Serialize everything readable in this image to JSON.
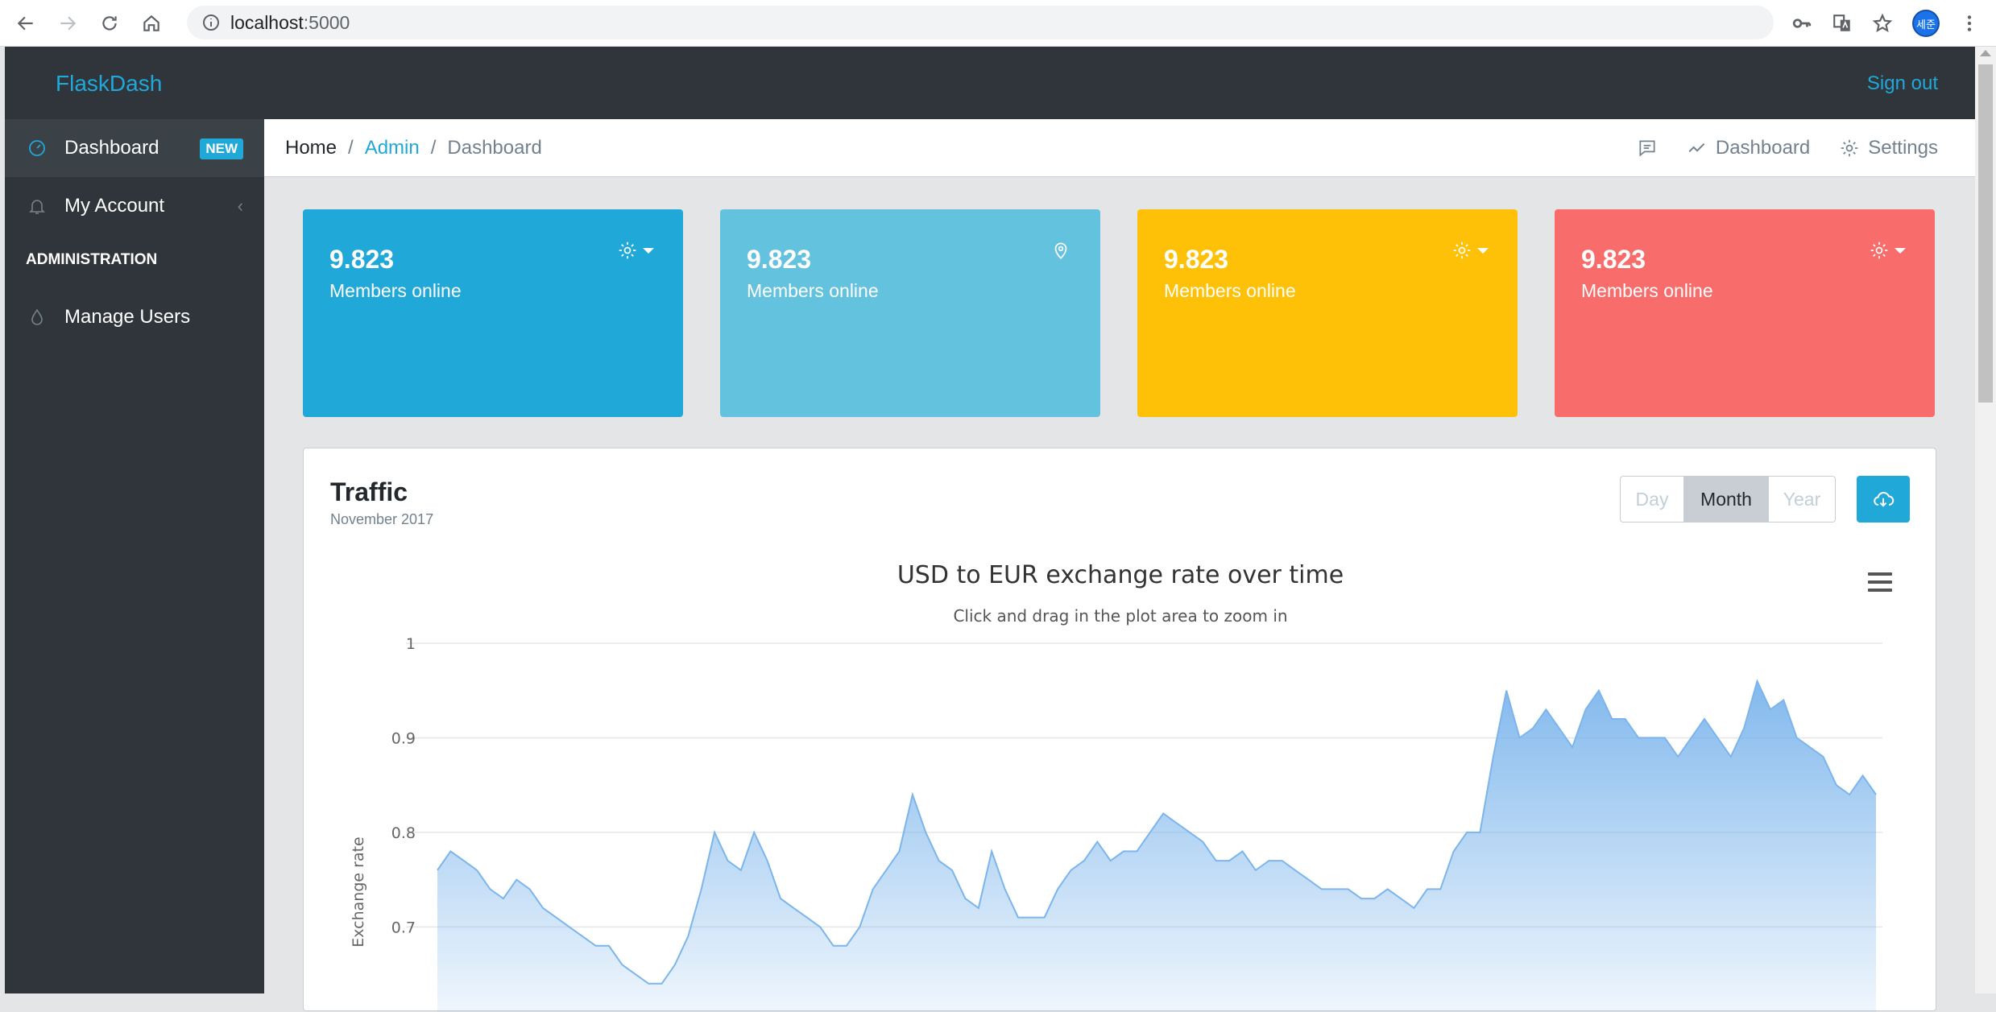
{
  "browser": {
    "url_host": "localhost",
    "url_port": ":5000",
    "profile_label": "세준"
  },
  "header": {
    "brand": "FlaskDash",
    "signout": "Sign out"
  },
  "sidebar": {
    "items": [
      {
        "label": "Dashboard",
        "badge": "NEW",
        "icon": "speedometer-icon"
      },
      {
        "label": "My Account",
        "icon": "bell-icon",
        "chevron": "‹"
      }
    ],
    "section_title": "ADMINISTRATION",
    "admin_items": [
      {
        "label": "Manage Users",
        "icon": "drop-icon"
      }
    ]
  },
  "breadcrumb": {
    "home": "Home",
    "admin": "Admin",
    "current": "Dashboard",
    "sep": "/",
    "right": {
      "dashboard": "Dashboard",
      "settings": "Settings"
    }
  },
  "cards": [
    {
      "value": "9.823",
      "label": "Members online",
      "color": "#20a8d8",
      "control": "gear-dropdown"
    },
    {
      "value": "9.823",
      "label": "Members online",
      "color": "#63c2de",
      "control": "location-pin"
    },
    {
      "value": "9.823",
      "label": "Members online",
      "color": "#ffc107",
      "control": "gear-dropdown"
    },
    {
      "value": "9.823",
      "label": "Members online",
      "color": "#f86c6b",
      "control": "gear-dropdown"
    }
  ],
  "traffic": {
    "title": "Traffic",
    "subtitle": "November 2017",
    "ranges": [
      "Day",
      "Month",
      "Year"
    ],
    "selected_range": "Month"
  },
  "chart_data": {
    "type": "area",
    "title": "USD to EUR exchange rate over time",
    "subtitle": "Click and drag in the plot area to zoom in",
    "ylabel": "Exchange rate",
    "yticks": [
      "1",
      "0.9",
      "0.8",
      "0.7"
    ],
    "ylim": [
      0.63,
      1.0
    ],
    "grid": true,
    "color": "#7cb5ec",
    "series": [
      {
        "values": [
          0.76,
          0.78,
          0.77,
          0.76,
          0.74,
          0.73,
          0.75,
          0.74,
          0.72,
          0.71,
          0.7,
          0.69,
          0.68,
          0.68,
          0.66,
          0.65,
          0.64,
          0.64,
          0.66,
          0.69,
          0.74,
          0.8,
          0.77,
          0.76,
          0.8,
          0.77,
          0.73,
          0.72,
          0.71,
          0.7,
          0.68,
          0.68,
          0.7,
          0.74,
          0.76,
          0.78,
          0.84,
          0.8,
          0.77,
          0.76,
          0.73,
          0.72,
          0.78,
          0.74,
          0.71,
          0.71,
          0.71,
          0.74,
          0.76,
          0.77,
          0.79,
          0.77,
          0.78,
          0.78,
          0.8,
          0.82,
          0.81,
          0.8,
          0.79,
          0.77,
          0.77,
          0.78,
          0.76,
          0.77,
          0.77,
          0.76,
          0.75,
          0.74,
          0.74,
          0.74,
          0.73,
          0.73,
          0.74,
          0.73,
          0.72,
          0.74,
          0.74,
          0.78,
          0.8,
          0.8,
          0.88,
          0.95,
          0.9,
          0.91,
          0.93,
          0.91,
          0.89,
          0.93,
          0.95,
          0.92,
          0.92,
          0.9,
          0.9,
          0.9,
          0.88,
          0.9,
          0.92,
          0.9,
          0.88,
          0.91,
          0.96,
          0.93,
          0.94,
          0.9,
          0.89,
          0.88,
          0.85,
          0.84,
          0.86,
          0.84
        ]
      }
    ]
  }
}
